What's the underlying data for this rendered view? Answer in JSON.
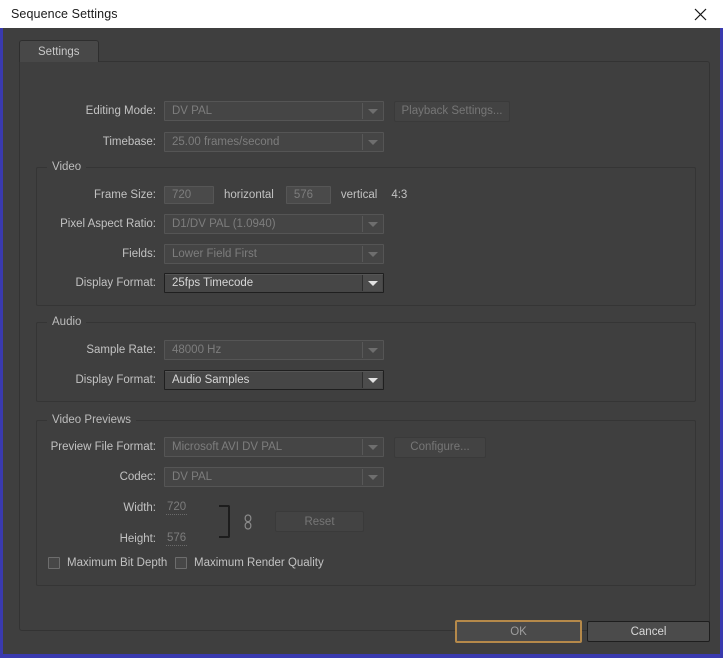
{
  "window": {
    "title": "Sequence Settings",
    "close_icon": "close-icon",
    "accent_border": "#3a3aae",
    "titlebar_bg": "#ffffff",
    "dialog_bg": "#3f3f3f"
  },
  "tabs": [
    {
      "label": "Settings",
      "selected": true
    }
  ],
  "top": {
    "editing_mode": {
      "label": "Editing Mode:",
      "value": "DV PAL",
      "enabled": false
    },
    "timebase": {
      "label": "Timebase:",
      "value": "25.00 frames/second",
      "enabled": false
    },
    "playback_settings": {
      "label": "Playback Settings...",
      "enabled": false
    }
  },
  "video": {
    "title": "Video",
    "frame_size": {
      "label": "Frame Size:",
      "horizontal_value": "720",
      "horizontal_label": "horizontal",
      "vertical_value": "576",
      "vertical_label": "vertical",
      "aspect": "4:3"
    },
    "pixel_aspect_ratio": {
      "label": "Pixel Aspect Ratio:",
      "value": "D1/DV PAL (1.0940)",
      "enabled": false
    },
    "fields": {
      "label": "Fields:",
      "value": "Lower Field First",
      "enabled": false
    },
    "display_format": {
      "label": "Display Format:",
      "value": "25fps Timecode",
      "enabled": true
    }
  },
  "audio": {
    "title": "Audio",
    "sample_rate": {
      "label": "Sample Rate:",
      "value": "48000 Hz",
      "enabled": false
    },
    "display_format": {
      "label": "Display Format:",
      "value": "Audio Samples",
      "enabled": true
    }
  },
  "video_previews": {
    "title": "Video Previews",
    "preview_file_format": {
      "label": "Preview File Format:",
      "value": "Microsoft AVI DV PAL",
      "enabled": false
    },
    "configure": {
      "label": "Configure...",
      "enabled": false
    },
    "codec": {
      "label": "Codec:",
      "value": "DV PAL",
      "enabled": false
    },
    "width": {
      "label": "Width:",
      "value": "720"
    },
    "height": {
      "label": "Height:",
      "value": "576"
    },
    "link_icon": "chain-link-icon",
    "reset": {
      "label": "Reset",
      "enabled": false
    },
    "max_bit_depth": {
      "label": "Maximum Bit Depth",
      "checked": false
    },
    "max_render_quality": {
      "label": "Maximum Render Quality",
      "checked": false
    }
  },
  "footer": {
    "ok": {
      "label": "OK",
      "is_default": true
    },
    "cancel": {
      "label": "Cancel",
      "is_default": false
    }
  }
}
